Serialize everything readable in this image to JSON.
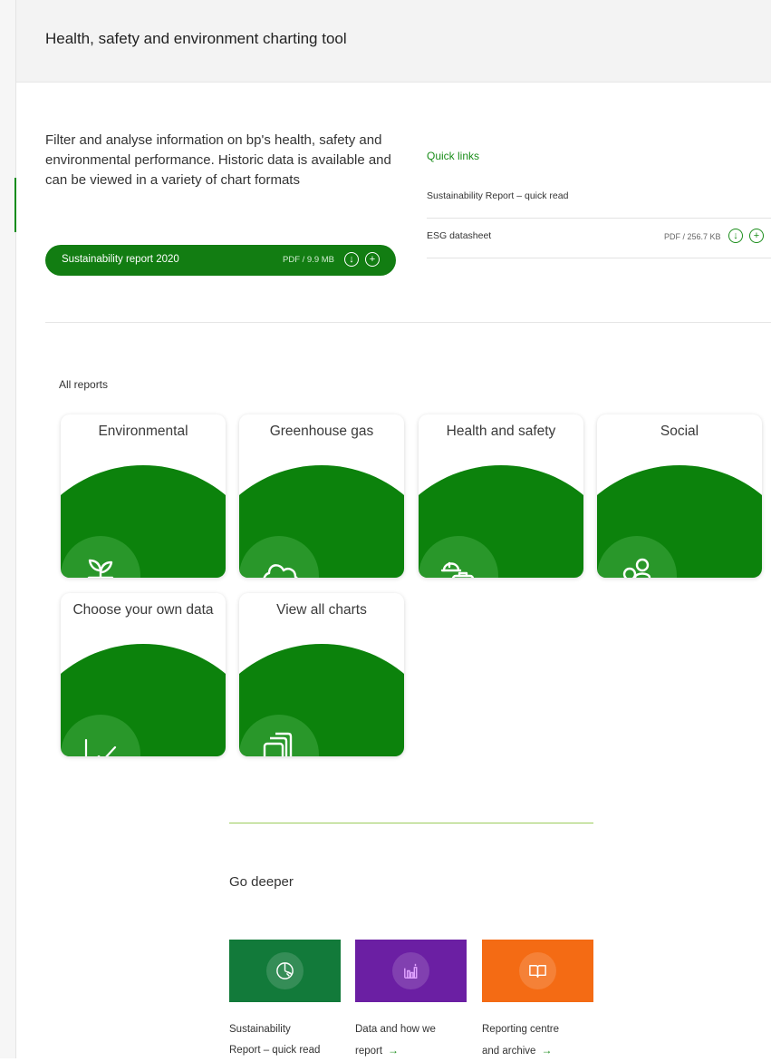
{
  "header": {
    "title": "Health, safety and environment charting tool"
  },
  "intro": {
    "text": "Filter and analyse information on bp's health, safety and environmental performance. Historic data is available and can be viewed in a variety of chart formats"
  },
  "report": {
    "label": "Sustainability report 2020",
    "meta": "PDF / 9.9 MB"
  },
  "quick_links": {
    "title": "Quick links",
    "items": [
      {
        "label": "Sustainability Report – quick read",
        "meta": ""
      },
      {
        "label": "ESG datasheet",
        "meta": "PDF / 256.7 KB"
      }
    ]
  },
  "all_reports": {
    "title": "All reports",
    "tiles": [
      {
        "label": "Environmental",
        "icon": "plant-icon"
      },
      {
        "label": "Greenhouse gas",
        "icon": "cloud-icon"
      },
      {
        "label": "Health and safety",
        "icon": "hardhat-medkit-icon"
      },
      {
        "label": "Social",
        "icon": "people-icon"
      },
      {
        "label": "Choose your own data",
        "icon": "line-chart-icon"
      },
      {
        "label": "View all charts",
        "icon": "stacked-cards-icon"
      }
    ]
  },
  "go_deeper": {
    "title": "Go deeper",
    "cards": [
      {
        "line1": "Sustainability",
        "line2": "Report – quick read",
        "color": "#127a3a",
        "icon": "pie-chart-icon"
      },
      {
        "line1": "Data and how we",
        "line2": "report",
        "color": "#6b1fa3",
        "icon": "bar-chart-icon"
      },
      {
        "line1": "Reporting centre",
        "line2": "and archive",
        "color": "#f46b14",
        "icon": "open-book-icon"
      }
    ]
  },
  "icons": {
    "download": "↓",
    "add": "+",
    "arrow_right": "→"
  },
  "colors": {
    "brand_green": "#0c820c",
    "accent_green": "#1a8d1a"
  }
}
